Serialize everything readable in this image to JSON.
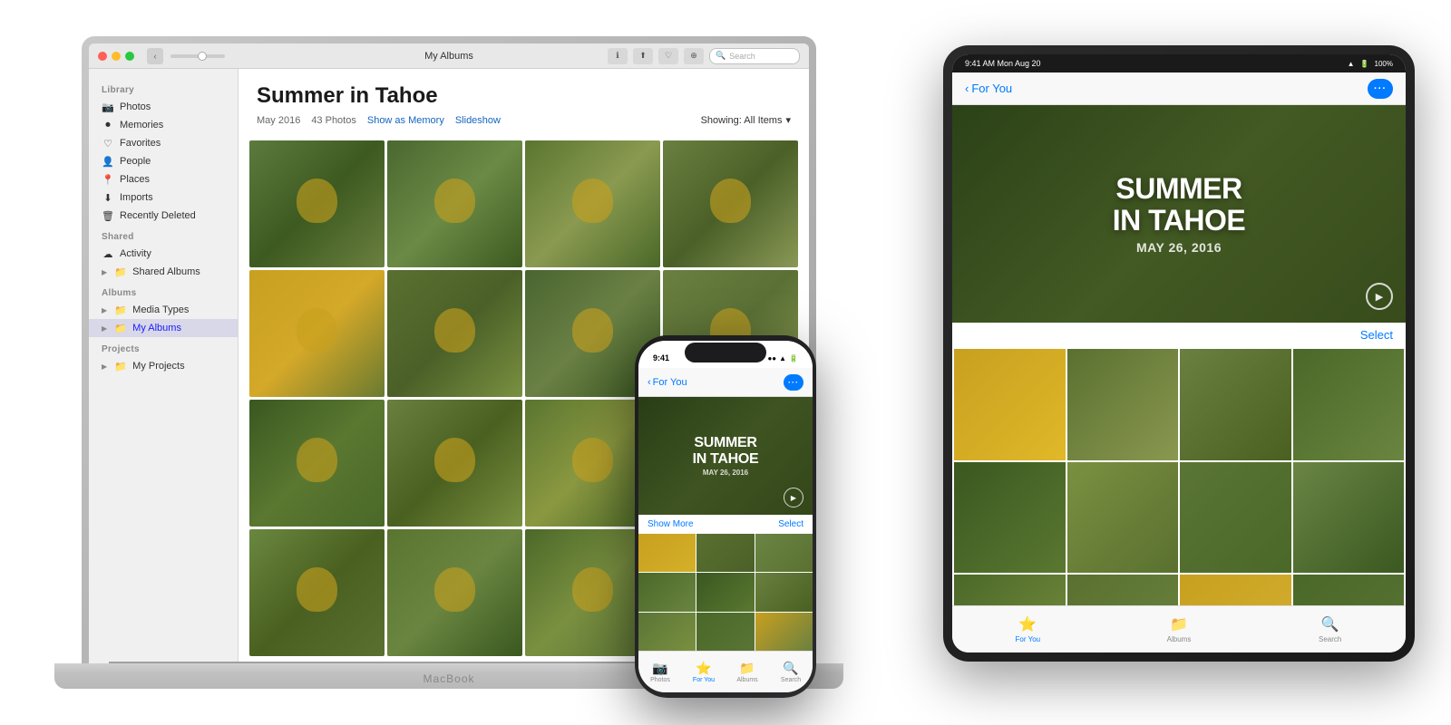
{
  "macbook": {
    "titlebar": {
      "title": "My Albums",
      "search_placeholder": "Search"
    },
    "sidebar": {
      "library_label": "Library",
      "shared_label": "Shared",
      "albums_label": "Albums",
      "projects_label": "Projects",
      "items": [
        {
          "id": "photos",
          "label": "Photos",
          "icon": "📷"
        },
        {
          "id": "memories",
          "label": "Memories",
          "icon": "⏺"
        },
        {
          "id": "favorites",
          "label": "Favorites",
          "icon": "♡"
        },
        {
          "id": "people",
          "label": "People",
          "icon": "👤"
        },
        {
          "id": "places",
          "label": "Places",
          "icon": "📍"
        },
        {
          "id": "imports",
          "label": "Imports",
          "icon": "⬇"
        },
        {
          "id": "recently-deleted",
          "label": "Recently Deleted",
          "icon": "🗑"
        },
        {
          "id": "activity",
          "label": "Activity",
          "icon": "☁"
        },
        {
          "id": "shared-albums",
          "label": "Shared Albums",
          "icon": "📁"
        },
        {
          "id": "media-types",
          "label": "Media Types",
          "icon": "📁"
        },
        {
          "id": "my-albums",
          "label": "My Albums",
          "icon": "📁"
        },
        {
          "id": "my-projects",
          "label": "My Projects",
          "icon": "📁"
        }
      ]
    },
    "main": {
      "album_title": "Summer in Tahoe",
      "date": "May 2016",
      "photo_count": "43 Photos",
      "show_as_memory": "Show as Memory",
      "slideshow": "Slideshow",
      "showing": "Showing: All Items",
      "label": "MacBook"
    }
  },
  "ipad": {
    "statusbar": {
      "time": "9:41 AM  Mon Aug 20",
      "wifi": "WiFi",
      "battery": "100%"
    },
    "nav": {
      "back_label": "For You",
      "more_label": "···"
    },
    "hero": {
      "title": "SUMMER\nIN TAHOE",
      "date": "MAY 26, 2016"
    },
    "select_label": "Select",
    "tabbar": [
      {
        "id": "for-you",
        "label": "For You",
        "icon": "⭐",
        "active": true
      },
      {
        "id": "albums",
        "label": "Albums",
        "icon": "📁"
      },
      {
        "id": "search",
        "label": "Search",
        "icon": "🔍"
      }
    ]
  },
  "iphone": {
    "statusbar": {
      "time": "9:41",
      "signal": "●●●",
      "wifi": "WiFi",
      "battery": "100%"
    },
    "nav": {
      "back_label": "For You",
      "more_label": "···"
    },
    "hero": {
      "title": "SUMMER\nIN TAHOE",
      "date": "MAY 26, 2016"
    },
    "show_more": "Show More",
    "select": "Select",
    "tabbar": [
      {
        "id": "photos",
        "label": "Photos",
        "icon": "📷"
      },
      {
        "id": "for-you",
        "label": "For You",
        "icon": "⭐",
        "active": true
      },
      {
        "id": "albums",
        "label": "Albums",
        "icon": "📁"
      },
      {
        "id": "search",
        "label": "Search",
        "icon": "🔍"
      }
    ]
  }
}
